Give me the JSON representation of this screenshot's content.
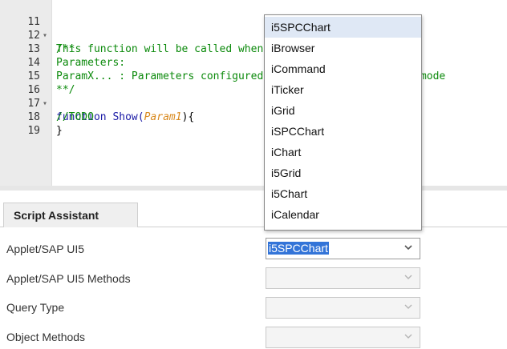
{
  "editor": {
    "lines": [
      {
        "num": "11",
        "fold": true,
        "text": "/**"
      },
      {
        "num": "12",
        "fold": false,
        "text": "This function will be called when the Applet is loaded"
      },
      {
        "num": "13",
        "fold": false,
        "text": "Parameters:"
      },
      {
        "num": "14",
        "fold": false,
        "text": "ParamX... : Parameters configured in the Script Assistant mode"
      },
      {
        "num": "15",
        "fold": false,
        "text": "**/"
      },
      {
        "num": "16",
        "fold": true,
        "keyword": "function",
        "fn_name": "Show(",
        "param": "Param1",
        "tail": "){"
      },
      {
        "num": "17",
        "fold": false,
        "text": "//TODO"
      },
      {
        "num": "18",
        "fold": false,
        "text": "}"
      },
      {
        "num": "19",
        "fold": false,
        "text": ""
      }
    ]
  },
  "assistant": {
    "tab_label": "Script Assistant",
    "rows": [
      {
        "label": "Applet/SAP UI5",
        "value": "i5SPCChart",
        "enabled": true
      },
      {
        "label": "Applet/SAP UI5 Methods",
        "value": "",
        "enabled": false
      },
      {
        "label": "Query Type",
        "value": "",
        "enabled": false
      },
      {
        "label": "Object Methods",
        "value": "",
        "enabled": false
      }
    ]
  },
  "dropdown": {
    "highlighted": "i5SPCChart",
    "options": [
      "i5SPCChart",
      "iBrowser",
      "iCommand",
      "iTicker",
      "iGrid",
      "iSPCChart",
      "iChart",
      "i5Grid",
      "i5Chart",
      "iCalendar"
    ]
  },
  "colors": {
    "comment": "#0c8a0c",
    "keyword": "#1a1aa6",
    "param": "#d98a1f",
    "selection": "#3374d8",
    "gutter": "#ebebeb"
  }
}
